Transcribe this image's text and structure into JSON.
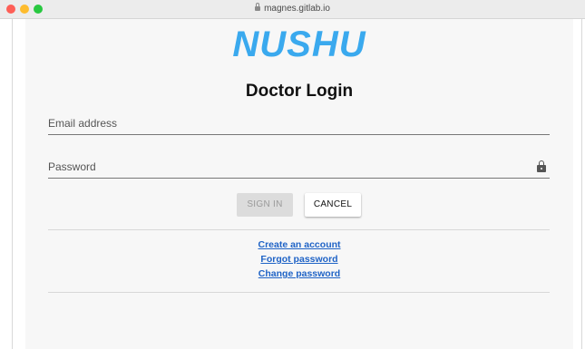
{
  "browser": {
    "url": "magnes.gitlab.io"
  },
  "page": {
    "logo": "NUSHU",
    "title": "Doctor Login",
    "email_placeholder": "Email address",
    "password_placeholder": "Password",
    "signin_label": "SIGN IN",
    "cancel_label": "CANCEL",
    "links": [
      "Create an account",
      "Forgot password",
      "Change password"
    ]
  },
  "colors": {
    "logo": "#3aa9ee",
    "link": "#1f63c6",
    "signin_disabled_bg": "#dcdcdc"
  },
  "icons": {
    "address_bar": "lock-icon",
    "password_field": "lock-icon"
  }
}
